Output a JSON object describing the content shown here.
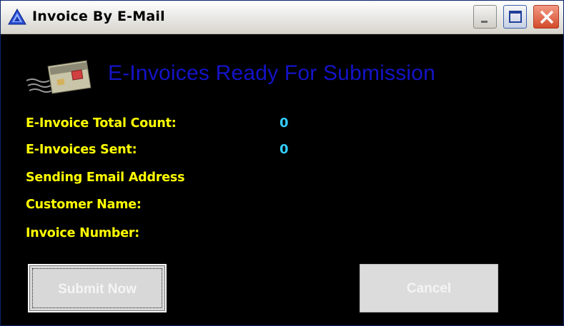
{
  "window": {
    "title": "Invoice By E-Mail",
    "controls": {
      "minimize": "minimize",
      "maximize": "maximize",
      "close": "close"
    }
  },
  "header": {
    "title": "E-Invoices Ready For Submission",
    "icon": "email-card-icon",
    "title_color": "#1414c8"
  },
  "fields": {
    "total_count": {
      "label": "E-Invoice Total Count:",
      "value": "0"
    },
    "sent": {
      "label": "E-Invoices Sent:",
      "value": "0"
    },
    "sending_email": {
      "label": "Sending Email Address",
      "value": ""
    },
    "customer_name": {
      "label": "Customer Name:",
      "value": ""
    },
    "invoice_number": {
      "label": "Invoice Number:",
      "value": ""
    }
  },
  "buttons": {
    "submit": "Submit Now",
    "cancel": "Cancel"
  },
  "colors": {
    "background": "#000000",
    "label": "#ffff00",
    "value": "#33ccff"
  }
}
